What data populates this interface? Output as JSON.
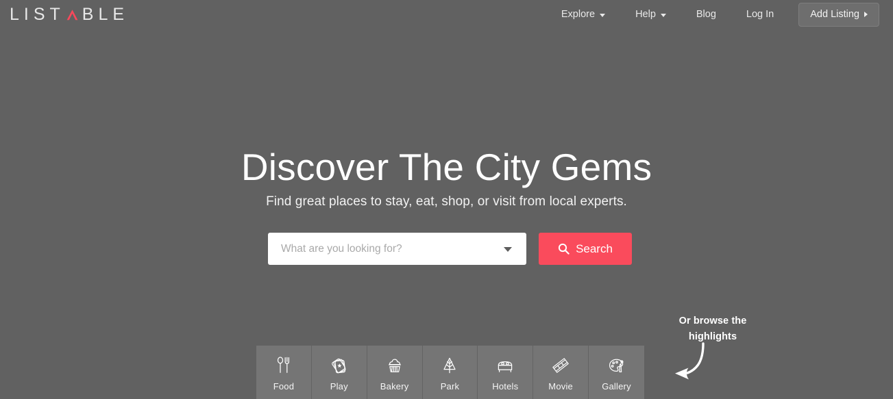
{
  "theme": {
    "page_bg": "#616161",
    "tile_bg": "#757575",
    "accent_red": "#fa4b5c",
    "text_light": "#ffffff",
    "button_bg": "#6e6e6e"
  },
  "header": {
    "brand": {
      "text_before": "LIST",
      "accent_letter": "A",
      "text_after": "BLE",
      "full_text": "LISTABLE",
      "accent_color": "#f9485b"
    },
    "nav": [
      {
        "label": "Explore",
        "has_dropdown": true,
        "icon": "chevron-down-icon"
      },
      {
        "label": "Help",
        "has_dropdown": true,
        "icon": "chevron-down-icon"
      },
      {
        "label": "Blog",
        "has_dropdown": false
      },
      {
        "label": "Log In",
        "has_dropdown": false
      }
    ],
    "cta": {
      "label": "Add Listing",
      "icon": "chevron-right-icon"
    }
  },
  "hero": {
    "title": "Discover The City Gems",
    "subtitle": "Find great places to stay, eat, shop, or visit from local experts."
  },
  "search": {
    "placeholder": "What are you looking for?",
    "value": "",
    "dropdown_icon": "chevron-down-icon",
    "button_label": "Search",
    "button_icon": "search-icon"
  },
  "categories": [
    {
      "label": "Food",
      "icon": "spoon-fork-icon"
    },
    {
      "label": "Play",
      "icon": "playing-cards-icon"
    },
    {
      "label": "Bakery",
      "icon": "cupcake-icon"
    },
    {
      "label": "Park",
      "icon": "pine-tree-icon"
    },
    {
      "label": "Hotels",
      "icon": "bed-icon"
    },
    {
      "label": "Movie",
      "icon": "film-strip-icon"
    },
    {
      "label": "Gallery",
      "icon": "paint-palette-icon"
    }
  ],
  "annotation": {
    "line1": "Or browse the",
    "line2": "highlights",
    "arrow_icon": "curved-arrow-left-icon"
  }
}
